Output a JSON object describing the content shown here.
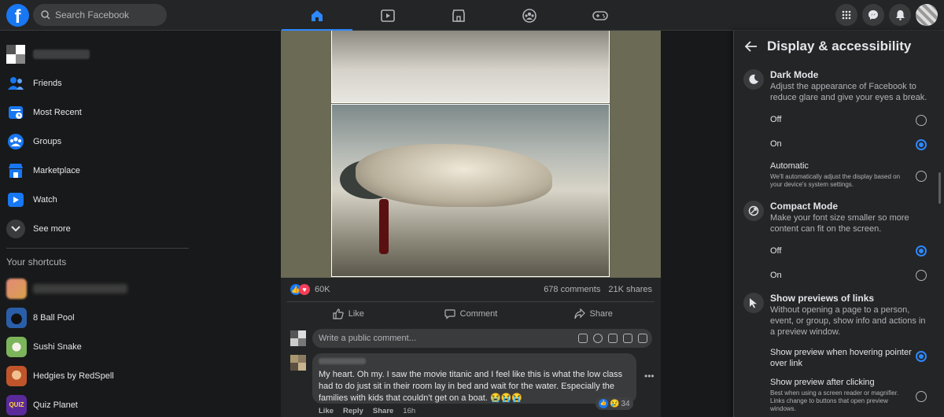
{
  "app": {
    "logo": "f"
  },
  "search": {
    "placeholder": "Search Facebook"
  },
  "nav_tabs": [
    {
      "name": "home",
      "icon": "home-icon"
    },
    {
      "name": "watch",
      "icon": "video-icon"
    },
    {
      "name": "marketplace",
      "icon": "store-icon"
    },
    {
      "name": "groups",
      "icon": "groups-icon"
    },
    {
      "name": "gaming",
      "icon": "gamepad-icon"
    }
  ],
  "sidebar": {
    "items": [
      {
        "label": "Friends",
        "icon": "friends-icon",
        "color": "#1877f2"
      },
      {
        "label": "Most Recent",
        "icon": "most-recent-icon",
        "color": "#1877f2"
      },
      {
        "label": "Groups",
        "icon": "groups-icon",
        "color": "#1877f2"
      },
      {
        "label": "Marketplace",
        "icon": "marketplace-icon",
        "color": "#1877f2"
      },
      {
        "label": "Watch",
        "icon": "watch-icon",
        "color": "#1877f2"
      },
      {
        "label": "See more",
        "icon": "chevron-down-icon",
        "color": "#3a3b3c"
      }
    ],
    "shortcuts_title": "Your shortcuts",
    "shortcuts": [
      {
        "label": "8 Ball Pool",
        "color": "#2a5ea8"
      },
      {
        "label": "Sushi Snake",
        "color": "#7bb45a"
      },
      {
        "label": "Hedgies by RedSpell",
        "color": "#c0552b"
      },
      {
        "label": "Quiz Planet",
        "color": "#5b2a9a"
      }
    ]
  },
  "post": {
    "reactions_count": "60K",
    "comments": "678 comments",
    "shares": "21K shares",
    "actions": {
      "like": "Like",
      "comment": "Comment",
      "share": "Share"
    },
    "comment_placeholder": "Write a public comment...",
    "comment": {
      "text": "My heart. Oh my. I saw the movie titanic and I feel like this is what the low class had to do just sit in their room lay in bed and wait for the water. Especially the families with kids that couldn't get on a boat. 😭😭😭",
      "reaction_count": "34",
      "actions": {
        "like": "Like",
        "reply": "Reply",
        "share": "Share",
        "time": "16h"
      }
    }
  },
  "panel": {
    "title": "Display & accessibility",
    "dark_mode": {
      "title": "Dark Mode",
      "desc": "Adjust the appearance of Facebook to reduce glare and give your eyes a break.",
      "options": [
        "Off",
        "On",
        "Automatic"
      ],
      "automatic_sub": "We'll automatically adjust the display based on your device's system settings.",
      "selected": "On"
    },
    "compact_mode": {
      "title": "Compact Mode",
      "desc": "Make your font size smaller so more content can fit on the screen.",
      "options": [
        "Off",
        "On"
      ],
      "selected": "Off"
    },
    "link_previews": {
      "title": "Show previews of links",
      "desc": "Without opening a page to a person, event, or group, show info and actions in a preview window.",
      "options": [
        "Show preview when hovering pointer over link",
        "Show preview after clicking"
      ],
      "after_click_sub": "Best when using a screen reader or magnifier. Links change to buttons that open preview windows.",
      "selected": "Show preview when hovering pointer over link"
    }
  },
  "colors": {
    "accent": "#2d88ff",
    "bg": "#18191a",
    "surface": "#242526",
    "brand": "#1877f2"
  }
}
